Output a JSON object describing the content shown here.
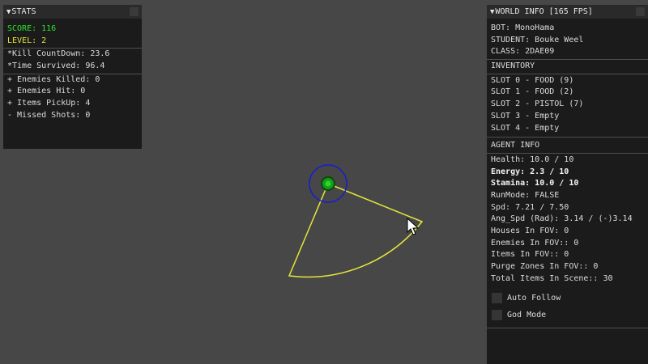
{
  "stats": {
    "title": "STATS",
    "score": "SCORE: 116",
    "level": "LEVEL: 2",
    "kill_countdown": "*Kill CountDown: 23.6",
    "time_survived": "*Time Survived: 96.4",
    "enemies_killed": "+ Enemies Killed: 0",
    "enemies_hit": "+ Enemies Hit: 0",
    "items_pickup": "+ Items PickUp: 4",
    "missed_shots": "- Missed Shots: 0"
  },
  "world": {
    "title": "WORLD INFO [165 FPS]",
    "bot": "BOT: MonoHama",
    "student": "STUDENT: Bouke Weel",
    "class": "CLASS: 2DAE09",
    "inventory_header": "INVENTORY",
    "slots": [
      "SLOT 0 - FOOD (9)",
      "SLOT 1 - FOOD (2)",
      "SLOT 2 - PISTOL (7)",
      "SLOT 3 - Empty",
      "SLOT 4 - Empty"
    ],
    "agent_header": "AGENT INFO",
    "health": "Health: 10.0 / 10",
    "energy": "Energy: 2.3 / 10",
    "stamina": "Stamina: 10.0 / 10",
    "runmode": "RunMode: FALSE",
    "spd": "Spd: 7.21 / 7.50",
    "ang_spd": "Ang_Spd (Rad): 3.14 / (-)3.14",
    "houses_fov": "Houses In FOV: 0",
    "enemies_fov": "Enemies In FOV:: 0",
    "items_fov": "Items In FOV:: 0",
    "purge_fov": "Purge Zones In FOV:: 0",
    "total_items": "Total Items In Scene:: 30",
    "auto_follow": "Auto Follow",
    "god_mode": "God Mode"
  },
  "colors": {
    "background": "#474747",
    "panel": "#1b1b1b",
    "score_text": "#2fe02f",
    "level_text": "#e0e03a",
    "fov_cone": "#e6e63c",
    "agent_ring": "#1b1bd0",
    "agent_body": "#1a9a1a"
  },
  "icons": {
    "collapse": "triangle-down-icon",
    "cursor": "mouse-pointer-icon"
  }
}
